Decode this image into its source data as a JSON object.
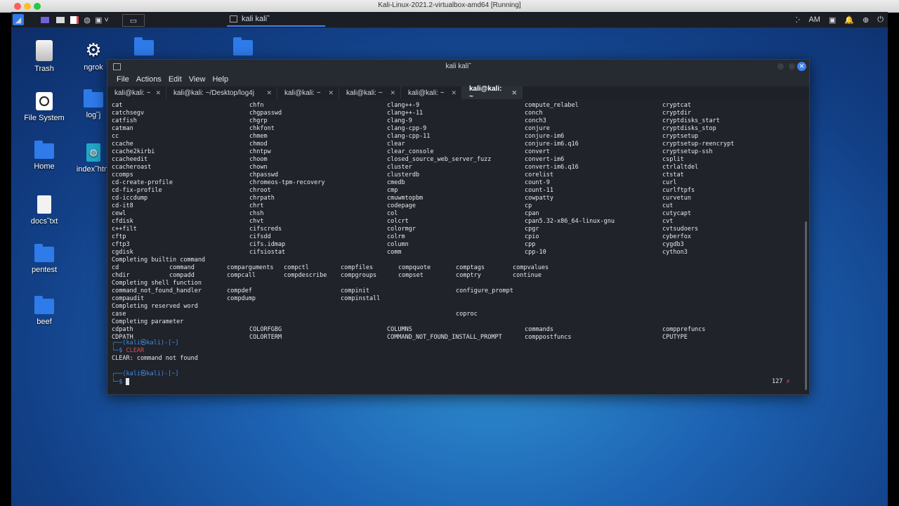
{
  "vbox": {
    "title": "Kali-Linux-2021.2-virtualbox-amd64 [Running]"
  },
  "panel": {
    "task_label": "kali   kali˜",
    "time": "AM"
  },
  "desktop": {
    "icons": [
      {
        "label": "Trash"
      },
      {
        "label": "ngrok"
      },
      {
        "label": "File System"
      },
      {
        "label": "log˜j"
      },
      {
        "label": "Home"
      },
      {
        "label": "index˜htm"
      },
      {
        "label": "docs˜txt"
      },
      {
        "label": "pentest"
      },
      {
        "label": "beef"
      }
    ]
  },
  "terminal": {
    "title": "kali  kali˜",
    "menu": [
      "File",
      "Actions",
      "Edit",
      "View",
      "Help"
    ],
    "tabs": [
      "kali@kali: ~",
      "kali@kali: ~/Desktop/log4j",
      "kali@kali: ~",
      "kali@kali: ~",
      "kali@kali: ~",
      "kali@kali: ~"
    ],
    "cols5": [
      [
        "cat",
        "chfn",
        "clang++-9",
        "compute_relabel",
        "cryptcat"
      ],
      [
        "catchsegv",
        "chgpasswd",
        "clang++-11",
        "conch",
        "cryptdir"
      ],
      [
        "catfish",
        "chgrp",
        "clang-9",
        "conch3",
        "cryptdisks_start"
      ],
      [
        "catman",
        "chkfont",
        "clang-cpp-9",
        "conjure",
        "cryptdisks_stop"
      ],
      [
        "cc",
        "chmem",
        "clang-cpp-11",
        "conjure-im6",
        "cryptsetup"
      ],
      [
        "ccache",
        "chmod",
        "clear",
        "conjure-im6.q16",
        "cryptsetup-reencrypt"
      ],
      [
        "ccache2kirbi",
        "chntpw",
        "clear_console",
        "convert",
        "cryptsetup-ssh"
      ],
      [
        "ccacheedit",
        "choom",
        "closed_source_web_server_fuzz",
        "convert-im6",
        "csplit"
      ],
      [
        "ccacheroast",
        "chown",
        "cluster",
        "convert-im6.q16",
        "ctrlaltdel"
      ],
      [
        "ccomps",
        "chpasswd",
        "clusterdb",
        "corelist",
        "ctstat"
      ],
      [
        "cd-create-profile",
        "chromeos-tpm-recovery",
        "cmedb",
        "count-9",
        "curl"
      ],
      [
        "cd-fix-profile",
        "chroot",
        "cmp",
        "count-11",
        "curlftpfs"
      ],
      [
        "cd-iccdump",
        "chrpath",
        "cmuwmtopbm",
        "cowpatty",
        "curvetun"
      ],
      [
        "cd-it8",
        "chrt",
        "codepage",
        "cp",
        "cut"
      ],
      [
        "cewl",
        "chsh",
        "col",
        "cpan",
        "cutycapt"
      ],
      [
        "cfdisk",
        "chvt",
        "colcrt",
        "cpan5.32-x86_64-linux-gnu",
        "cvt"
      ],
      [
        "c++filt",
        "cifscreds",
        "colormgr",
        "cpgr",
        "cvtsudoers"
      ],
      [
        "cftp",
        "cifsdd",
        "colrm",
        "cpio",
        "cyberfox"
      ],
      [
        "cftp3",
        "cifs.idmap",
        "column",
        "cpp",
        "cygdb3"
      ],
      [
        "cgdisk",
        "cifsiostat",
        "comm",
        "cpp-10",
        "cython3"
      ]
    ],
    "hdr_builtin": "Completing builtin command",
    "cols8": [
      [
        "cd",
        "command",
        "comparguments",
        "compctl",
        "compfiles",
        "compquote",
        "comptags",
        "compvalues"
      ],
      [
        "chdir",
        "compadd",
        "compcall",
        "compdescribe",
        "compgroups",
        "compset",
        "comptry",
        "continue"
      ]
    ],
    "hdr_shellfn": "Completing shell function",
    "shellfn": [
      [
        "command_not_found_handler",
        "",
        "compdef",
        "",
        "compinit",
        "",
        "configure_prompt",
        ""
      ],
      [
        "compaudit",
        "",
        "compdump",
        "",
        "compinstall",
        "",
        "",
        ""
      ]
    ],
    "hdr_reserved": "Completing reserved word",
    "reserved": [
      [
        "case",
        "",
        "",
        "",
        "",
        "",
        "coproc",
        ""
      ]
    ],
    "hdr_param": "Completing parameter",
    "params": [
      [
        "cdpath",
        "COLORFGBG",
        "COLUMNS",
        "commands",
        "compprefuncs"
      ],
      [
        "CDPATH",
        "COLORTERM",
        "COMMAND_NOT_FOUND_INSTALL_PROMPT",
        "comppostfuncs",
        "CPUTYPE"
      ]
    ],
    "prompt1": "┌──(kali㉿kali)-[~]",
    "prompt1_cmd_prefix": "└─$ ",
    "cmd": "CLEAR",
    "error": "CLEAR: command not found",
    "prompt2": "┌──(kali㉿kali)-[~]",
    "prompt2_prefix": "└─$ ",
    "exit_code": "127",
    "exit_mark": "✗"
  }
}
